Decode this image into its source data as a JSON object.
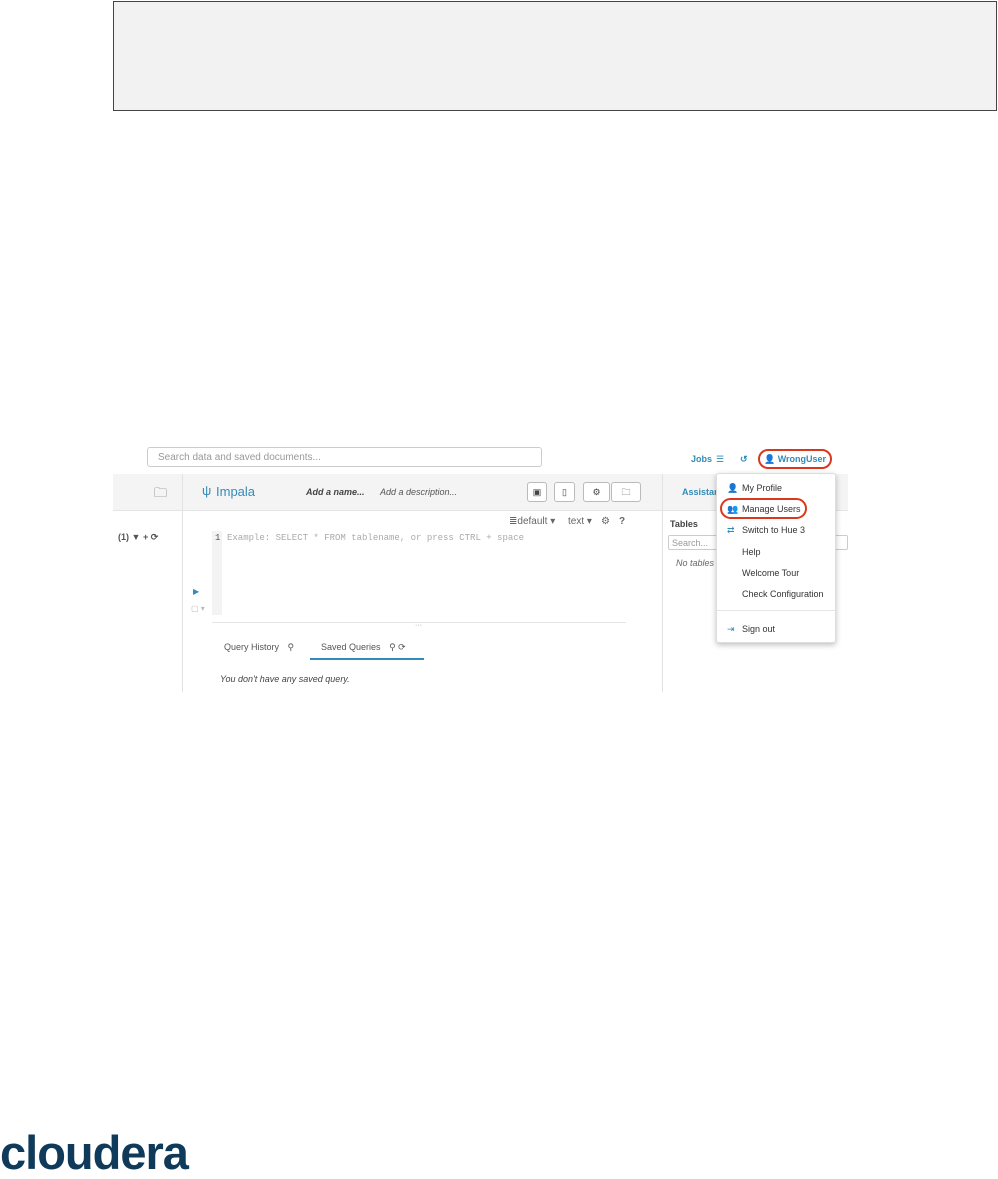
{
  "search": {
    "placeholder": "Search data and saved documents..."
  },
  "topbar": {
    "jobs_label": "Jobs",
    "user_label": "WrongUser"
  },
  "toolbar": {
    "editor_name": "Impala",
    "add_name": "Add a name...",
    "add_description": "Add a description...",
    "assist_label": "Assistant"
  },
  "editor": {
    "snippet_count": "(1)",
    "database": "default",
    "format": "text",
    "help": "?",
    "line_number": "1",
    "placeholder": "Example: SELECT * FROM tablename, or press CTRL + space"
  },
  "bottom_tabs": [
    {
      "label": "Query History",
      "active": false
    },
    {
      "label": "Saved Queries",
      "active": true
    }
  ],
  "empty_message": "You don't have any saved query.",
  "assist_panel": {
    "tables_label": "Tables",
    "search_placeholder": "Search...",
    "no_tables": "No tables"
  },
  "user_menu": {
    "items": [
      {
        "label": "My Profile",
        "icon": "user-icon"
      },
      {
        "label": "Manage Users",
        "icon": "users-icon"
      },
      {
        "label": "Switch to Hue 3",
        "icon": "exchange-icon"
      },
      {
        "label": "Help",
        "icon": ""
      },
      {
        "label": "Welcome Tour",
        "icon": ""
      },
      {
        "label": "Check Configuration",
        "icon": ""
      },
      {
        "label": "Sign out",
        "icon": "sign-out-icon"
      }
    ]
  },
  "logo": {
    "text": "cloudera"
  },
  "colors": {
    "accent": "#338bb8",
    "highlight": "#d9381e",
    "logo": "#0f3a5a"
  }
}
